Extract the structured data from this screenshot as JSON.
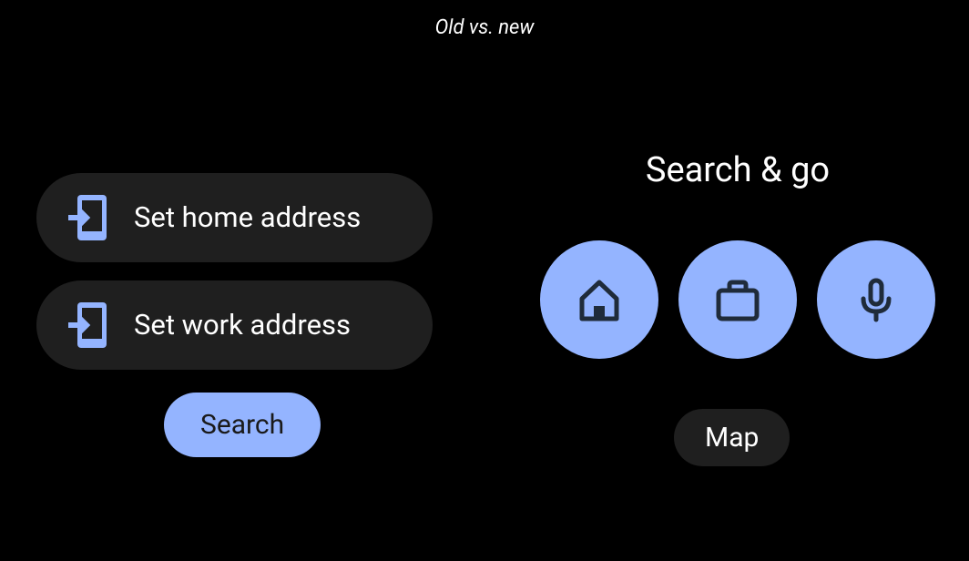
{
  "title": "Old vs. new",
  "left": {
    "items": [
      {
        "label": "Set home address",
        "icon": "phone-arrow-icon"
      },
      {
        "label": "Set work address",
        "icon": "phone-arrow-icon"
      }
    ],
    "search_label": "Search"
  },
  "right": {
    "title": "Search & go",
    "circles": [
      {
        "icon": "home-icon"
      },
      {
        "icon": "briefcase-icon"
      },
      {
        "icon": "mic-icon"
      }
    ],
    "map_label": "Map"
  },
  "colors": {
    "accent": "#94b4ff",
    "pill_bg": "#1f1f1f",
    "icon_dark": "#1f2b3a"
  }
}
